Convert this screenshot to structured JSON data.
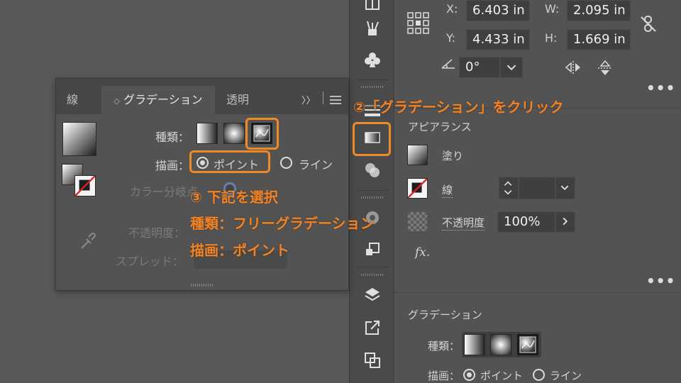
{
  "transform": {
    "x_label": "X:",
    "x_value": "6.403 in",
    "y_label": "Y:",
    "y_value": "4.433 in",
    "w_label": "W:",
    "w_value": "2.095 in",
    "h_label": "H:",
    "h_value": "1.669 in",
    "angle_value": "0°"
  },
  "appearance": {
    "title": "アピアランス",
    "fill_label": "塗り",
    "stroke_label": "線",
    "opacity_label": "不透明度",
    "opacity_value": "100%",
    "fx_label": "fx."
  },
  "gradient_section": {
    "title": "グラデーション",
    "type_label": "種類：",
    "draw_label": "描画：",
    "point_label": "ポイント",
    "line_label": "ライン"
  },
  "float_panel": {
    "tabs": [
      {
        "label": "線"
      },
      {
        "label": "グラデーション"
      },
      {
        "label": "透明"
      }
    ],
    "tab_sort_glyph": "◇",
    "collapse_glyph": "〉〉",
    "type_label": "種類：",
    "draw_label": "描画：",
    "point_label": "ポイント",
    "line_label": "ライン",
    "color_stop_label": "カラー分岐点",
    "opacity_label": "不透明度：",
    "spread_label": "スプレッド："
  },
  "annotations": {
    "step2": "②「グラデーション」をクリック",
    "step3_title": "③ 下記を選択",
    "step3_line1": "種類：フリーグラデーション",
    "step3_line2": "描画：ポイント"
  },
  "colors": {
    "accent_orange": "#f08a24",
    "panel_bg": "#535353",
    "field_bg": "#3f3f3f"
  }
}
